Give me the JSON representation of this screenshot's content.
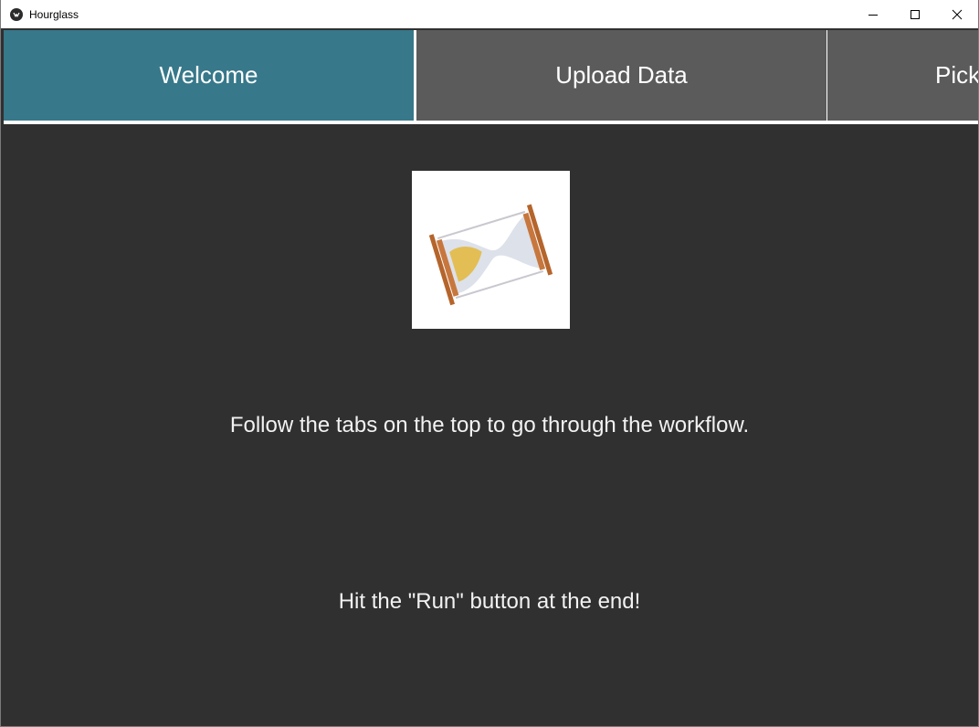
{
  "window": {
    "title": "Hourglass",
    "minimize_icon": "minimize-icon",
    "maximize_icon": "maximize-icon",
    "close_icon": "close-icon"
  },
  "tabs": [
    {
      "label": "Welcome",
      "active": true
    },
    {
      "label": "Upload Data",
      "active": false
    },
    {
      "label": "Pick",
      "active": false
    }
  ],
  "colors": {
    "active_tab": "#37788a",
    "inactive_tab": "#5b5b5b",
    "content_background": "#303030",
    "text": "#f2f2f2"
  },
  "welcome": {
    "logo_icon": "hourglass-icon",
    "instruction": "Follow the tabs on the top to go through the workflow.",
    "hint": "Hit the \"Run\" button at the end!"
  }
}
